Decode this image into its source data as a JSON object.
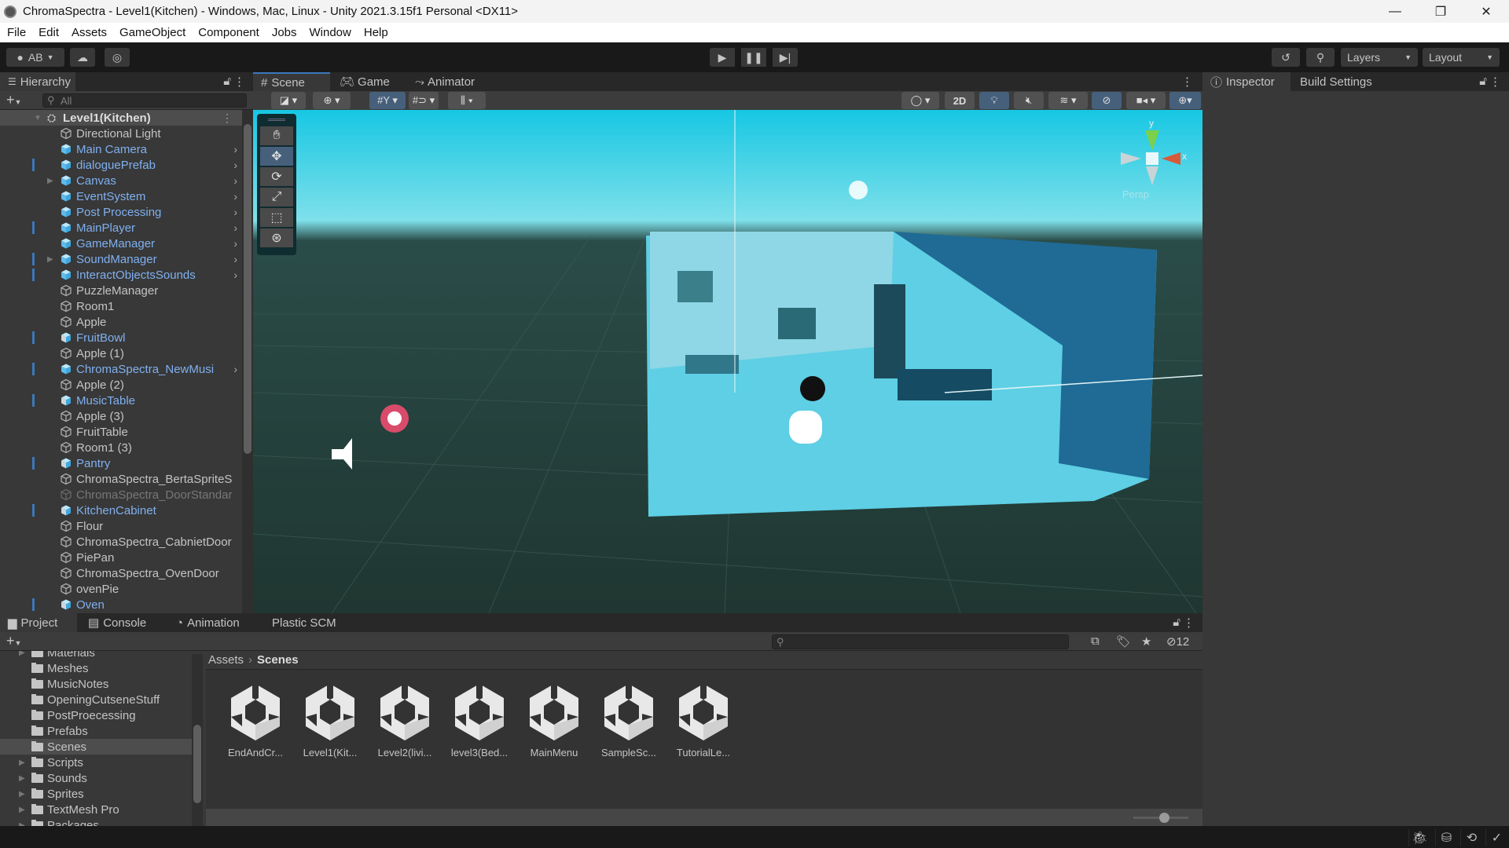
{
  "window": {
    "title": "ChromaSpectra - Level1(Kitchen) - Windows, Mac, Linux - Unity 2021.3.15f1 Personal <DX11>",
    "minimize": "—",
    "maximize": "❐",
    "close": "✕"
  },
  "menu": [
    "File",
    "Edit",
    "Assets",
    "GameObject",
    "Component",
    "Jobs",
    "Window",
    "Help"
  ],
  "toolbar": {
    "account": "AB",
    "layers": "Layers",
    "layout": "Layout"
  },
  "hierarchy": {
    "tab": "Hierarchy",
    "search_placeholder": "All",
    "scene": "Level1(Kitchen)",
    "items": [
      {
        "label": "Directional Light",
        "type": "object",
        "color": "normal"
      },
      {
        "label": "Main Camera",
        "type": "prefab",
        "color": "blue",
        "chevron": true
      },
      {
        "label": "dialoguePrefab",
        "type": "prefab",
        "color": "blue",
        "chevron": true,
        "mark": true
      },
      {
        "label": "Canvas",
        "type": "prefab",
        "color": "blue",
        "chevron": true,
        "expand": true
      },
      {
        "label": "EventSystem",
        "type": "prefab",
        "color": "blue",
        "chevron": true
      },
      {
        "label": "Post Processing",
        "type": "prefab",
        "color": "blue",
        "chevron": true
      },
      {
        "label": "MainPlayer",
        "type": "prefab",
        "color": "blue",
        "chevron": true,
        "mark": true
      },
      {
        "label": "GameManager",
        "type": "prefab",
        "color": "blue",
        "chevron": true
      },
      {
        "label": "SoundManager",
        "type": "prefab",
        "color": "blue",
        "chevron": true,
        "expand": true,
        "mark": true
      },
      {
        "label": "InteractObjectsSounds",
        "type": "prefab",
        "color": "blue",
        "chevron": true,
        "mark": true
      },
      {
        "label": "PuzzleManager",
        "type": "object",
        "color": "normal"
      },
      {
        "label": "Room1",
        "type": "object",
        "color": "normal"
      },
      {
        "label": "Apple",
        "type": "object",
        "color": "normal"
      },
      {
        "label": "FruitBowl",
        "type": "model",
        "color": "blue",
        "mark": true
      },
      {
        "label": "Apple (1)",
        "type": "object",
        "color": "normal"
      },
      {
        "label": "ChromaSpectra_NewMusi",
        "type": "prefab",
        "color": "blue",
        "chevron": true,
        "mark": true
      },
      {
        "label": "Apple (2)",
        "type": "object",
        "color": "normal"
      },
      {
        "label": "MusicTable",
        "type": "model",
        "color": "blue",
        "mark": true
      },
      {
        "label": "Apple (3)",
        "type": "object",
        "color": "normal"
      },
      {
        "label": "FruitTable",
        "type": "object",
        "color": "normal"
      },
      {
        "label": "Room1 (3)",
        "type": "object",
        "color": "normal"
      },
      {
        "label": "Pantry",
        "type": "model",
        "color": "blue",
        "mark": true
      },
      {
        "label": "ChromaSpectra_BertaSpriteS",
        "type": "object",
        "color": "normal"
      },
      {
        "label": "ChromaSpectra_DoorStandar",
        "type": "object",
        "color": "dim"
      },
      {
        "label": "KitchenCabinet",
        "type": "model",
        "color": "blue",
        "mark": true
      },
      {
        "label": "Flour",
        "type": "object",
        "color": "normal"
      },
      {
        "label": "ChromaSpectra_CabnietDoor",
        "type": "object",
        "color": "normal"
      },
      {
        "label": "PiePan",
        "type": "object",
        "color": "normal"
      },
      {
        "label": "ChromaSpectra_OvenDoor",
        "type": "object",
        "color": "normal"
      },
      {
        "label": "ovenPie",
        "type": "object",
        "color": "normal"
      },
      {
        "label": "Oven",
        "type": "model",
        "color": "blue",
        "mark": true
      }
    ]
  },
  "scene": {
    "tabs": [
      "Scene",
      "Game",
      "Animator"
    ],
    "active_tab": "Scene",
    "btn_2d": "2D",
    "persp": "Persp",
    "axis_x": "x",
    "axis_y": "y"
  },
  "inspector": {
    "tabs": [
      "Inspector",
      "Build Settings"
    ]
  },
  "project": {
    "tabs": [
      "Project",
      "Console",
      "Animation",
      "Plastic SCM"
    ],
    "folders": [
      {
        "label": "Materials",
        "expand": true
      },
      {
        "label": "Meshes"
      },
      {
        "label": "MusicNotes"
      },
      {
        "label": "OpeningCutseneStuff"
      },
      {
        "label": "PostProecessing"
      },
      {
        "label": "Prefabs"
      },
      {
        "label": "Scenes",
        "selected": true
      },
      {
        "label": "Scripts",
        "expand": true
      },
      {
        "label": "Sounds",
        "expand": true
      },
      {
        "label": "Sprites",
        "expand": true
      },
      {
        "label": "TextMesh Pro",
        "expand": true
      },
      {
        "label": "Packages",
        "expand": true
      }
    ],
    "breadcrumb": [
      "Assets",
      "Scenes"
    ],
    "assets": [
      "EndAndCr...",
      "Level1(Kit...",
      "Level2(livi...",
      "level3(Bed...",
      "MainMenu",
      "SampleSc...",
      "TutorialLe..."
    ],
    "hidden_count": "12",
    "zoom_slider": 0.55
  }
}
